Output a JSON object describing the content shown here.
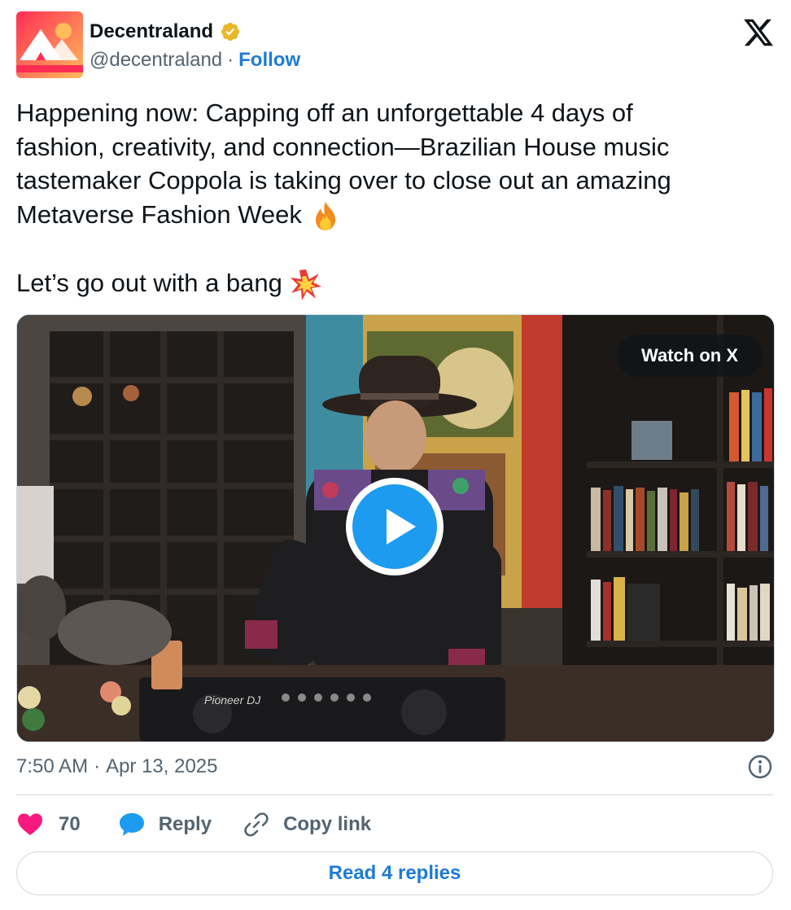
{
  "author": {
    "display_name": "Decentraland",
    "handle": "@decentraland",
    "separator": "·",
    "follow_label": "Follow",
    "verified_badge_color": "#e8b829"
  },
  "tweet": {
    "line1": "Happening now: Capping off an unforgettable 4 days of",
    "line2": "fashion, creativity, and connection—Brazilian House music",
    "line3": "tastemaker Coppola is taking over to close out an amazing",
    "line4": "Metaverse Fashion Week ",
    "line5": "Let’s go out with a bang ",
    "emoji_1": "fire-icon",
    "emoji_2": "collision-icon"
  },
  "media": {
    "watch_label": "Watch on X",
    "play_icon": "play-icon",
    "deck_brand": "Pioneer DJ"
  },
  "meta": {
    "time": "7:50 AM",
    "separator": "·",
    "date": "Apr 13, 2025"
  },
  "actions": {
    "like_count": "70",
    "reply_label": "Reply",
    "copy_label": "Copy link"
  },
  "read_replies_label": "Read 4 replies",
  "colors": {
    "accent": "#1d9bf0",
    "link": "#1d7bd8",
    "like": "#f91880",
    "muted": "#536471",
    "border": "#cfd9de"
  }
}
